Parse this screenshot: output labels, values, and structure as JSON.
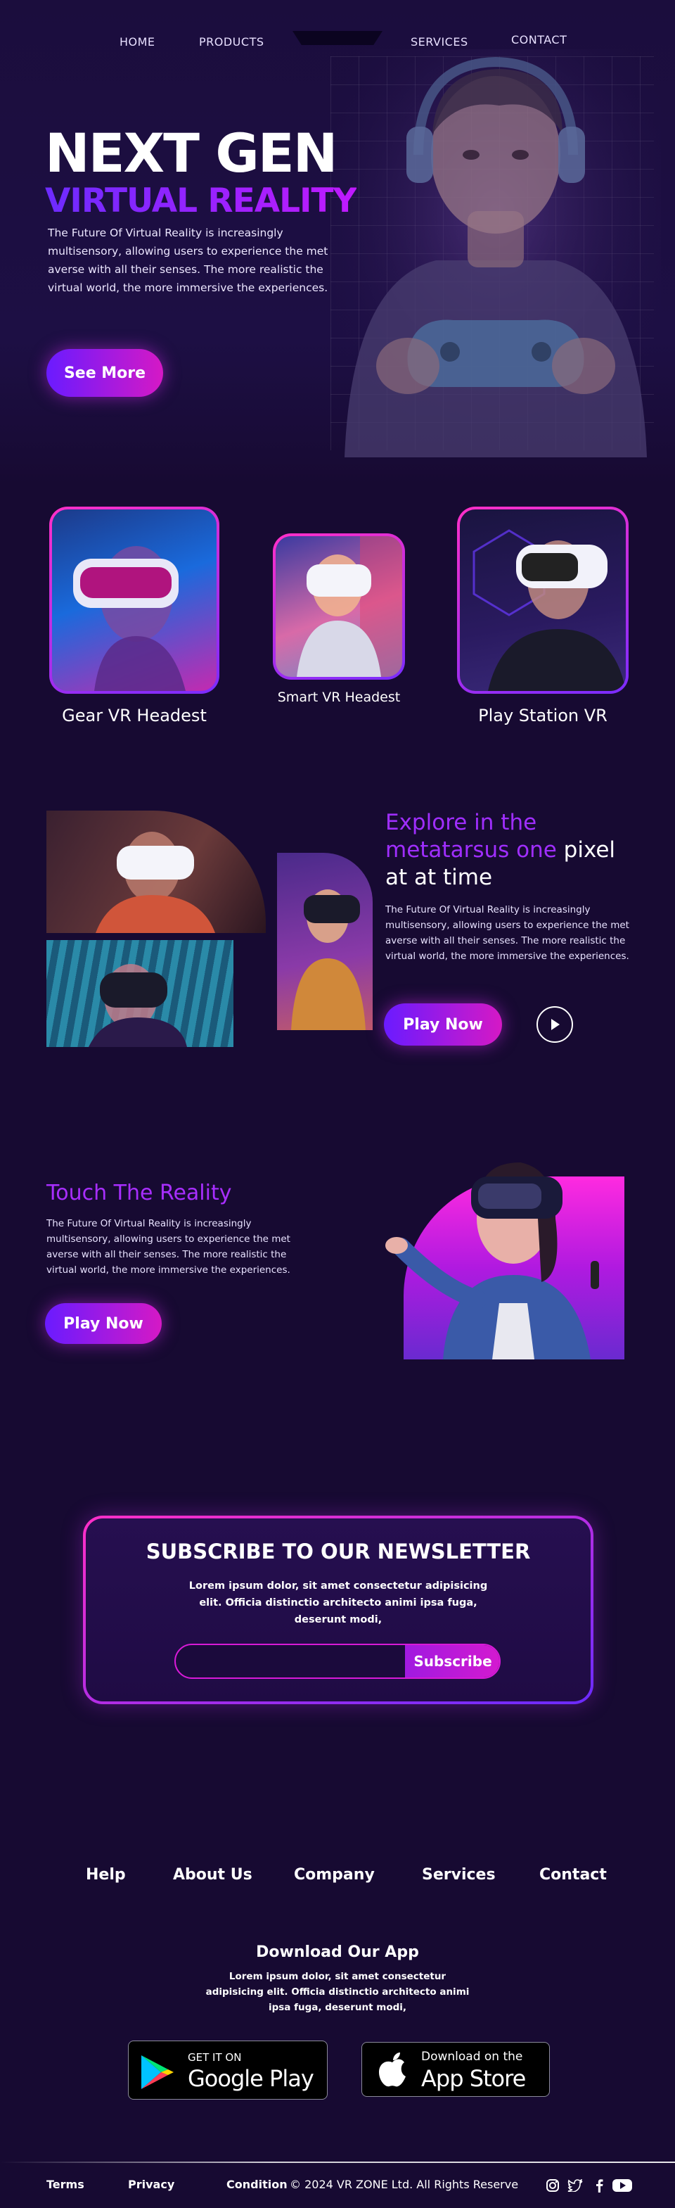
{
  "nav": {
    "home": "HOME",
    "products": "PRODUCTS",
    "services": "SERVICES",
    "contact": "CONTACT"
  },
  "hero": {
    "title_line1": "NEXT GEN",
    "title_line2": "VIRTUAL REALITY",
    "description": "The Future Of Virtual Reality is increasingly multisensory, allowing users to experience the met averse with all their senses. The more realistic the virtual world, the more immersive the experiences.",
    "cta": "See More"
  },
  "products": [
    {
      "label": "Gear VR Headest"
    },
    {
      "label": "Smart VR Headest"
    },
    {
      "label": "Play Station VR"
    }
  ],
  "explore": {
    "title_part1": "Explore in the",
    "title_part2": "metatarsus one",
    "title_part3": " pixel",
    "title_part4": "at at time",
    "description": "The Future Of Virtual Reality is increasingly multisensory, allowing users to experience the met averse with all their senses. The more realistic the virtual world, the more immersive the experiences.",
    "cta": "Play Now"
  },
  "touch": {
    "title": "Touch The Reality",
    "description": "The Future Of Virtual Reality is increasingly multisensory, allowing users to experience the met averse with all their senses. The more realistic the virtual world, the more immersive the experiences.",
    "cta": "Play Now"
  },
  "newsletter": {
    "title": "SUBSCRIBE TO OUR NEWSLETTER",
    "text": "Lorem ipsum dolor, sit amet consectetur adipisicing elit. Officia distinctio architecto animi ipsa fuga, deserunt modi,",
    "input_placeholder": "",
    "button": "Subscribe"
  },
  "footer": {
    "links": [
      "Help",
      "About Us",
      "Company",
      "Services",
      "Contact"
    ],
    "download_title": "Download Our App",
    "download_text": "Lorem ipsum dolor, sit amet consectetur adipisicing elit. Officia distinctio architecto animi ipsa fuga, deserunt modi,",
    "google": {
      "small": "GET IT ON",
      "big": "Google Play"
    },
    "apple": {
      "small": "Download on the",
      "big": "App Store"
    },
    "bottom_links": [
      "Terms",
      "Privacy",
      "Condition"
    ],
    "copyright": "© 2024 VR ZONE Ltd. All Rights Reserve",
    "social_icons": [
      "instagram-icon",
      "twitter-icon",
      "facebook-icon",
      "youtube-icon"
    ]
  },
  "colors": {
    "background": "#170a32",
    "accent_purple": "#6a1bff",
    "accent_pink": "#d519c5",
    "title_gradient_start": "#6d2bff",
    "title_gradient_end": "#c01aff"
  }
}
